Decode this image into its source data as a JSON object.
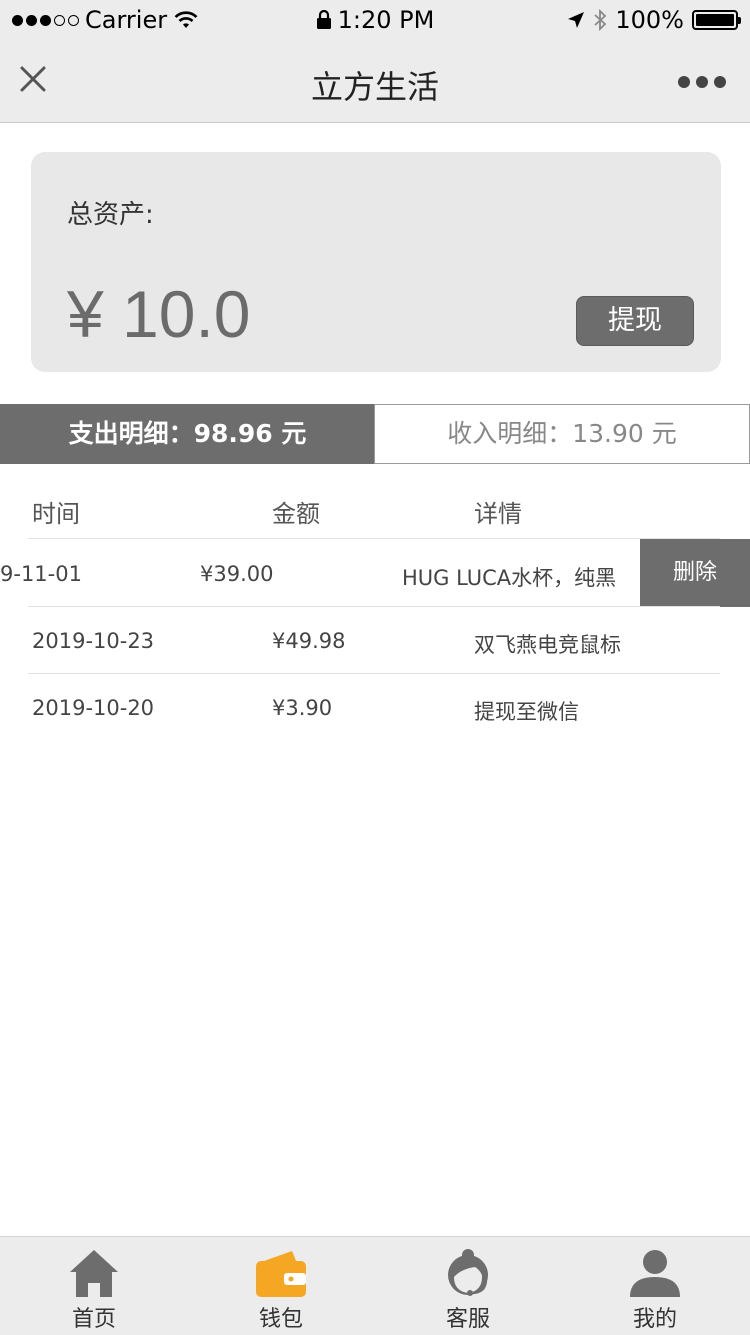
{
  "status_bar": {
    "carrier": "Carrier",
    "time": "1:20 PM",
    "battery": "100%"
  },
  "nav": {
    "title": "立方生活"
  },
  "asset": {
    "label": "总资产:",
    "amount": "¥ 10.0",
    "withdraw_label": "提现"
  },
  "tabs": {
    "expense": "支出明细：98.96 元",
    "income": "收入明细：13.90 元"
  },
  "table": {
    "headers": [
      "时间",
      "金额",
      "详情"
    ],
    "rows": [
      {
        "date": "9-11-01",
        "amount": "¥39.00",
        "detail": "HUG LUCA水杯，纯黑"
      },
      {
        "date": "2019-10-23",
        "amount": "¥49.98",
        "detail": "双飞燕电竞鼠标"
      },
      {
        "date": "2019-10-20",
        "amount": "¥3.90",
        "detail": "提现至微信"
      }
    ],
    "delete_label": "删除"
  },
  "tab_bar": {
    "items": [
      {
        "label": "首页",
        "icon": "home-icon"
      },
      {
        "label": "钱包",
        "icon": "wallet-icon",
        "active": true
      },
      {
        "label": "客服",
        "icon": "customer-service-icon"
      },
      {
        "label": "我的",
        "icon": "user-icon"
      }
    ],
    "active_color": "#f5a623",
    "inactive_color": "#6d6d6d"
  }
}
